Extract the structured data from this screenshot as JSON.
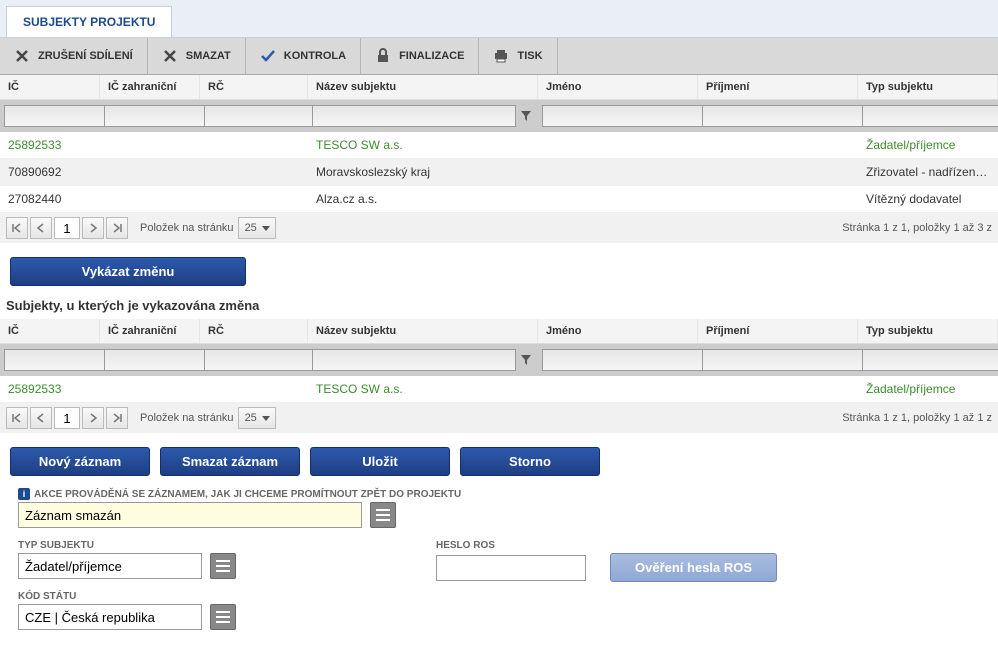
{
  "tab": {
    "title": "SUBJEKTY PROJEKTU"
  },
  "toolbar": {
    "zruseni": "ZRUŠENÍ SDÍLENÍ",
    "smazat": "SMAZAT",
    "kontrola": "KONTROLA",
    "finalizace": "FINALIZACE",
    "tisk": "TISK"
  },
  "columns": {
    "ic": "IČ",
    "icz": "IČ zahraniční",
    "rc": "RČ",
    "nazev": "Název subjektu",
    "jmeno": "Jméno",
    "prijmeni": "Příjmení",
    "typ": "Typ subjektu"
  },
  "grid1": {
    "rows": [
      {
        "ic": "25892533",
        "nazev": "TESCO SW a.s.",
        "typ": "Žadatel/příjemce",
        "hl": true
      },
      {
        "ic": "70890692",
        "nazev": "Moravskoslezský kraj",
        "typ": "Zřizovatel - nadřízený kra",
        "hl": false
      },
      {
        "ic": "27082440",
        "nazev": "Alza.cz a.s.",
        "typ": "Vítězný dodavatel",
        "hl": false
      }
    ],
    "pager": {
      "page": "1",
      "perpage_label": "Položek na stránku",
      "perpage": "25",
      "summary": "Stránka 1 z 1, položky 1 až 3 z"
    }
  },
  "btn_vykazat": "Vykázat změnu",
  "section2_title": "Subjekty, u kterých je vykazována změna",
  "grid2": {
    "rows": [
      {
        "ic": "25892533",
        "nazev": "TESCO SW a.s.",
        "typ": "Žadatel/příjemce",
        "hl": true
      }
    ],
    "pager": {
      "page": "1",
      "perpage_label": "Položek na stránku",
      "perpage": "25",
      "summary": "Stránka 1 z 1, položky 1 až 1 z"
    }
  },
  "actions": {
    "novy": "Nový záznam",
    "smazat": "Smazat záznam",
    "ulozit": "Uložit",
    "storno": "Storno"
  },
  "form": {
    "akce_label": "AKCE PROVÁDĚNÁ SE ZÁZNAMEM, JAK JI CHCEME PROMÍTNOUT ZPĚT DO PROJEKTU",
    "akce_value": "Záznam smazán",
    "typ_label": "TYP SUBJEKTU",
    "typ_value": "Žadatel/příjemce",
    "heslo_label": "HESLO ROS",
    "heslo_value": "",
    "overeni_btn": "Ověření hesla ROS",
    "kod_label": "KÓD STÁTU",
    "kod_value": "CZE | Česká republika"
  }
}
